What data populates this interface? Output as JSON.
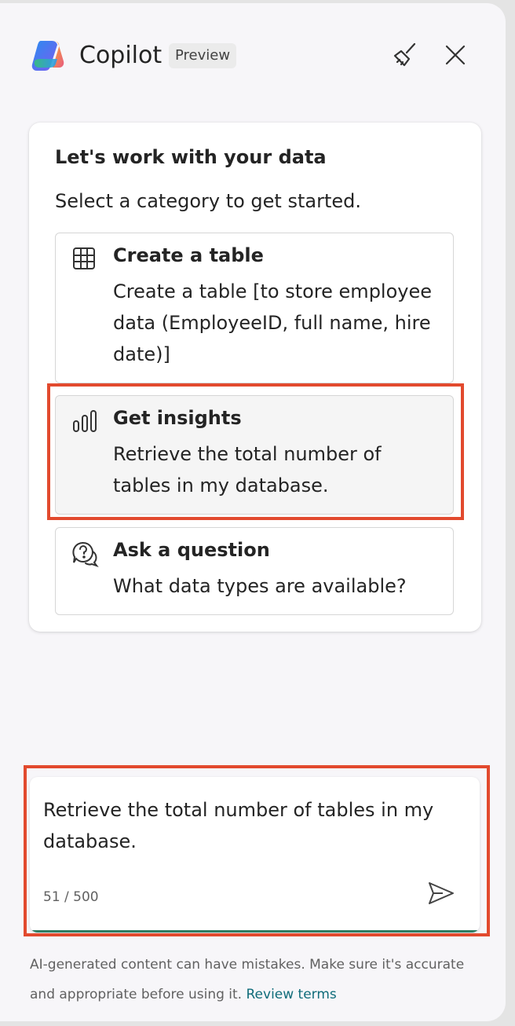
{
  "header": {
    "title": "Copilot",
    "badge": "Preview",
    "logo_icon": "copilot-logo",
    "clear_icon": "broom-icon",
    "close_icon": "close-icon"
  },
  "card": {
    "title": "Let's work with your data",
    "subtitle": "Select a category to get started.",
    "options": [
      {
        "icon": "table-icon",
        "title": "Create a table",
        "description": "Create a table [to store employee data (EmployeeID, full name, hire date)]"
      },
      {
        "icon": "chart-icon",
        "title": "Get insights",
        "description": "Retrieve the total number of tables in my database."
      },
      {
        "icon": "question-chat-icon",
        "title": "Ask a question",
        "description": "What data types are available?"
      }
    ]
  },
  "input": {
    "value": "Retrieve the total number of tables in my database.",
    "counter": "51 / 500",
    "send_icon": "send-icon"
  },
  "footer": {
    "text": "AI-generated content can have mistakes. Make sure it's accurate and appropriate before using it.",
    "link": "Review terms"
  },
  "colors": {
    "highlight": "#e24a2e",
    "link": "#0f6c7a",
    "input_underline": "#2f7d62"
  }
}
